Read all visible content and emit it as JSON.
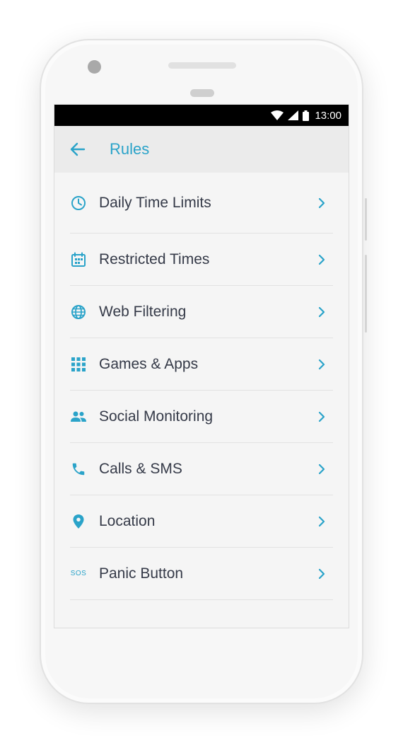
{
  "status_bar": {
    "time": "13:00"
  },
  "app_bar": {
    "title": "Rules"
  },
  "colors": {
    "accent": "#2aa3c9",
    "text": "#353a48"
  },
  "rules": [
    {
      "label": "Daily Time Limits",
      "icon": "clock-icon"
    },
    {
      "label": "Restricted Times",
      "icon": "calendar-icon"
    },
    {
      "label": "Web Filtering",
      "icon": "globe-icon"
    },
    {
      "label": "Games & Apps",
      "icon": "grid-icon"
    },
    {
      "label": "Social Monitoring",
      "icon": "people-icon"
    },
    {
      "label": "Calls & SMS",
      "icon": "phone-icon"
    },
    {
      "label": "Location",
      "icon": "location-pin-icon"
    },
    {
      "label": "Panic Button",
      "icon": "sos-icon",
      "icon_text": "SOS"
    }
  ]
}
